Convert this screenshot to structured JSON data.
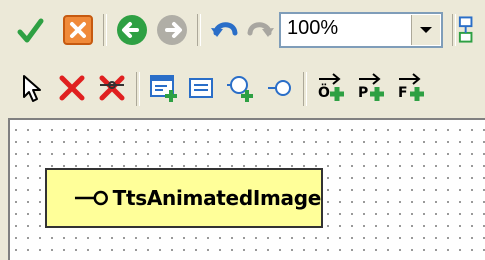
{
  "toolbar_top": {
    "buttons": [
      {
        "name": "accept-icon"
      },
      {
        "name": "cancel-icon"
      },
      {
        "name": "back-icon"
      },
      {
        "name": "forward-icon"
      },
      {
        "name": "undo-icon"
      },
      {
        "name": "redo-icon"
      }
    ],
    "zoom": {
      "value": "100%"
    },
    "trailing_icon": "structure-icon"
  },
  "toolbar_design": {
    "buttons": [
      {
        "name": "select-pointer-icon"
      },
      {
        "name": "delete-icon"
      },
      {
        "name": "delete-link-icon"
      },
      {
        "name": "add-form-icon"
      },
      {
        "name": "form-icon"
      },
      {
        "name": "add-interface-icon"
      },
      {
        "name": "interface-icon"
      },
      {
        "name": "add-method-icon"
      },
      {
        "name": "add-property-icon"
      },
      {
        "name": "add-event-icon"
      }
    ]
  },
  "canvas": {
    "component": {
      "label": "TtsAnimatedImage",
      "fill": "#ffff99"
    }
  },
  "colors": {
    "toolbar": "#ece9d8",
    "green": "#2ea043",
    "red": "#e02020"
  }
}
